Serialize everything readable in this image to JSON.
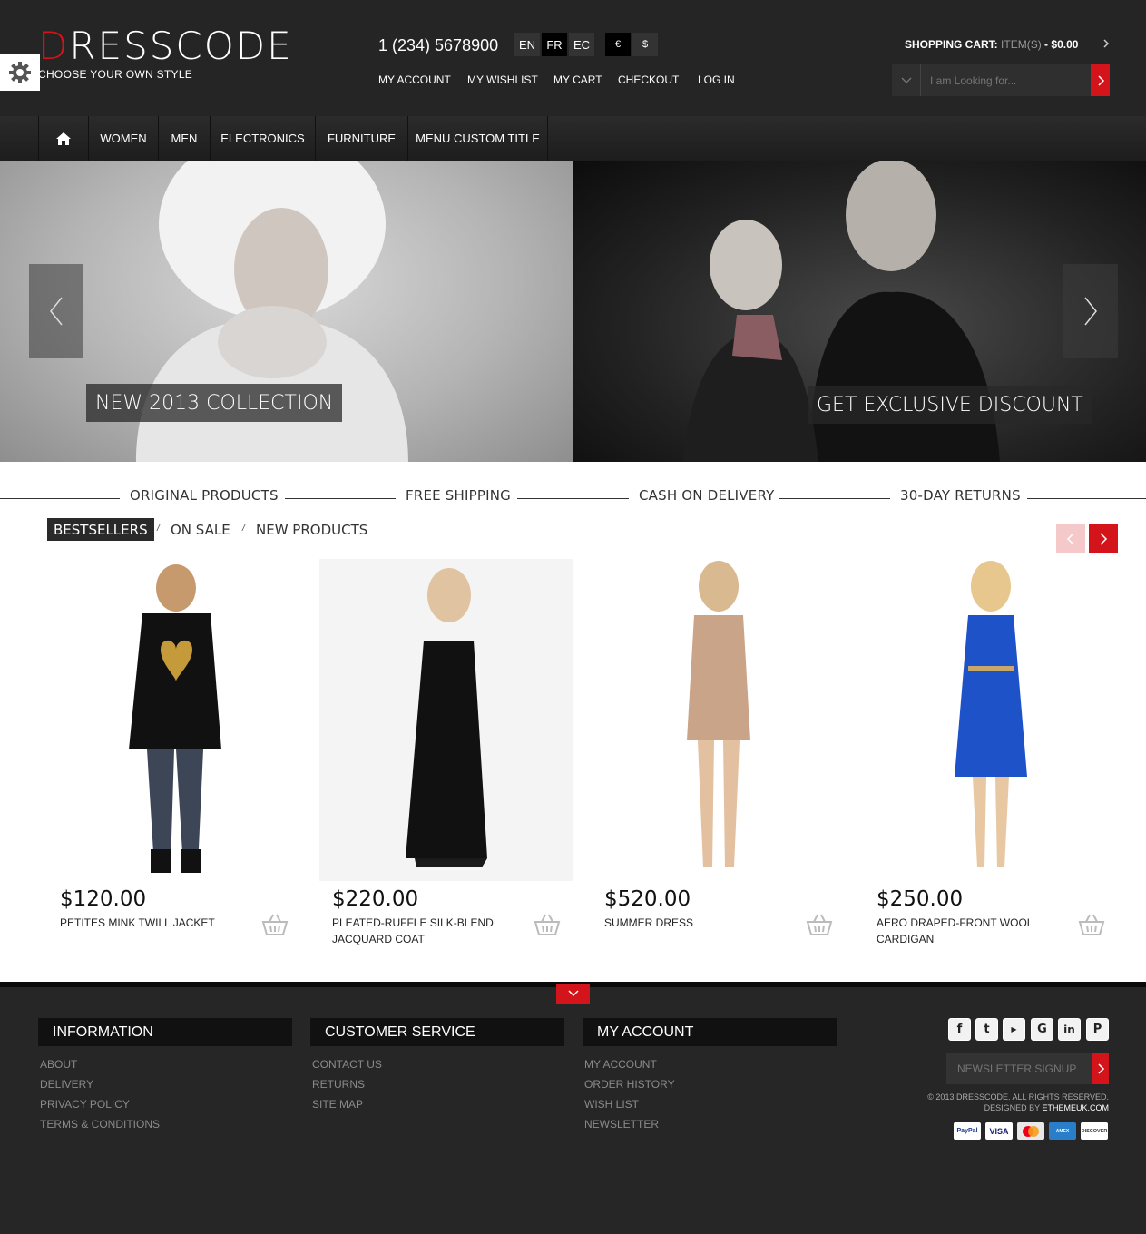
{
  "logo": {
    "first_letter": "D",
    "rest": "RESSCODE",
    "tagline": "CHOOSE YOUR OWN STYLE"
  },
  "header": {
    "phone": "1 (234) 5678900",
    "languages": [
      "EN",
      "FR",
      "EC"
    ],
    "active_language": "FR",
    "currencies": [
      "€",
      "$"
    ],
    "top_links": [
      "MY ACCOUNT",
      "MY WISHLIST",
      "MY CART",
      "CHECKOUT",
      "LOG IN"
    ],
    "cart": {
      "label": "SHOPPING CART:",
      "items": "ITEM(S)",
      "separator": "-",
      "total": "$0.00"
    },
    "search": {
      "placeholder": "I am Looking for..."
    }
  },
  "nav": {
    "items": [
      "WOMEN",
      "MEN",
      "ELECTRONICS",
      "FURNITURE",
      "MENU CUSTOM TITLE"
    ]
  },
  "banners": [
    {
      "caption": "NEW 2013 COLLECTION"
    },
    {
      "caption": "GET EXCLUSIVE DISCOUNT"
    }
  ],
  "features": [
    "ORIGINAL PRODUCTS",
    "FREE SHIPPING",
    "CASH ON DELIVERY",
    "30-DAY RETURNS"
  ],
  "tabs": {
    "items": [
      "BESTSELLERS",
      "ON SALE",
      "NEW PRODUCTS"
    ],
    "active": "BESTSELLERS",
    "separator": "/"
  },
  "products": [
    {
      "price": "$120.00",
      "name": "PETITES MINK TWILL JACKET"
    },
    {
      "price": "$220.00",
      "name": "PLEATED-RUFFLE SILK-BLEND JACQUARD COAT"
    },
    {
      "price": "$520.00",
      "name": "SUMMER DRESS"
    },
    {
      "price": "$250.00",
      "name": "AERO DRAPED-FRONT WOOL CARDIGAN"
    }
  ],
  "footer": {
    "columns": [
      {
        "title": "INFORMATION",
        "links": [
          "ABOUT",
          "DELIVERY",
          "PRIVACY POLICY",
          "TERMS & CONDITIONS"
        ]
      },
      {
        "title": "CUSTOMER SERVICE",
        "links": [
          "CONTACT US",
          "RETURNS",
          "SITE MAP"
        ]
      },
      {
        "title": "MY ACCOUNT",
        "links": [
          "MY ACCOUNT",
          "ORDER HISTORY",
          "WISH LIST",
          "NEWSLETTER"
        ]
      }
    ],
    "social": [
      "facebook-icon",
      "twitter-icon",
      "youtube-icon",
      "google-icon",
      "linkedin-icon",
      "pinterest-icon"
    ],
    "newsletter_placeholder": "NEWSLETTER SIGNUP",
    "copyright": "© 2013 DRESSCODE. ALL RIGHTS RESERVED.",
    "designed_by": "DESIGNED BY",
    "designer": "ETHEMEUK.COM",
    "payments": [
      "PayPal",
      "VISA",
      "MasterCard",
      "AMERICAN EXPRESS",
      "DISCOVER"
    ]
  },
  "colors": {
    "accent": "#d4141b",
    "header_bg": "#252525",
    "footer_bg": "#262626"
  }
}
